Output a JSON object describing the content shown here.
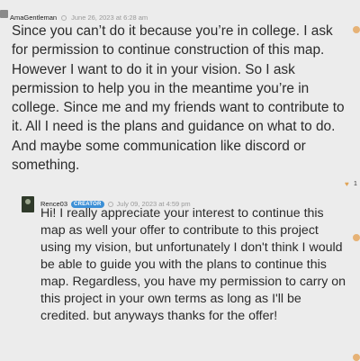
{
  "comments": [
    {
      "author": "AmaGentleman",
      "date": "June 26, 2023 at 6:28 am",
      "text": "Since you can’t do it because you’re in college. I ask for permission to continue construction of this map. However I want to do it in your vision. So I ask permission to help you in the meantime you’re in college. Since me and my friends want to contribute to it. All I need is the plans and guidance on what to do. And maybe some communication like discord or something.",
      "like_count": "1",
      "avatar_icon": "avatar-icon",
      "like_icon": "heart-icon"
    }
  ],
  "reply": {
    "author": "Rence03",
    "badge": "CREATOR",
    "date": "July 09, 2023 at 4:59 pm",
    "text": "Hi! I really appreciate your interest to continue this map as well your offer to contribute to this project using my vision, but unfortunately I don't think I would be able to guide you with the plans to continue this map. Regardless, you have my permission to carry on this project in your own terms as long as I'll be credited. but anyways thanks for the offer!",
    "badge_color": "#3b8fd6"
  },
  "colors": {
    "background": "#ececec",
    "accent": "#e6b276"
  }
}
